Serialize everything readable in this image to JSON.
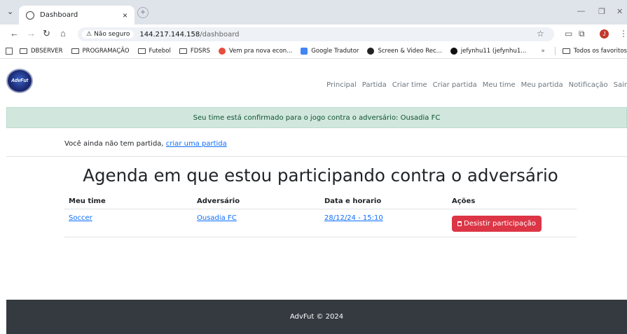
{
  "browser": {
    "tab_title": "Dashboard",
    "tab_close": "×",
    "new_tab": "+",
    "security_label": "Não seguro",
    "url_host": "144.217.144.158",
    "url_path": "/dashboard",
    "profile_initial": "J",
    "bookmarks": [
      {
        "label": "DBSERVER",
        "icon": "folder-icon"
      },
      {
        "label": "PROGRAMAÇÃO",
        "icon": "folder-icon"
      },
      {
        "label": "Futebol",
        "icon": "folder-icon"
      },
      {
        "label": "FDSRS",
        "icon": "folder-icon"
      },
      {
        "label": "Vem pra nova econ...",
        "icon": "site-icon",
        "color": "#e74c3c"
      },
      {
        "label": "Google Tradutor",
        "icon": "translate-icon",
        "color": "#4285f4"
      },
      {
        "label": "Screen & Video Rec...",
        "icon": "record-icon",
        "color": "#222222"
      },
      {
        "label": "jefynhu11 (jefynhu1...",
        "icon": "github-icon",
        "color": "#111111"
      }
    ],
    "bookmarks_overflow": "»",
    "all_bookmarks": "Todos os favoritos"
  },
  "navbar": {
    "logo_text": "AdvFut",
    "menu": [
      "Principal",
      "Partida",
      "Criar time",
      "Criar partida",
      "Meu time",
      "Meu partida",
      "Notificação",
      "Sair"
    ]
  },
  "alert": {
    "message": "Seu time está confirmado para o jogo contra o adversário: Ousadia FC",
    "color": "#d1e7dd"
  },
  "no_match": {
    "text": "Você ainda não tem partida,",
    "link": "criar uma partida"
  },
  "agenda": {
    "heading": "Agenda em que estou participando contra o adversário",
    "headers": [
      "Meu time",
      "Adversário",
      "Data e horario",
      "Ações"
    ],
    "rows": [
      {
        "team": "Soccer",
        "opponent": "Ousadia FC",
        "datetime": "28/12/24 - 15:10",
        "action": "Desistir participação"
      }
    ]
  },
  "footer": {
    "text": "AdvFut © 2024"
  },
  "colors": {
    "danger": "#dc3545",
    "link": "#0d6efd",
    "footer_bg": "#343a40"
  }
}
